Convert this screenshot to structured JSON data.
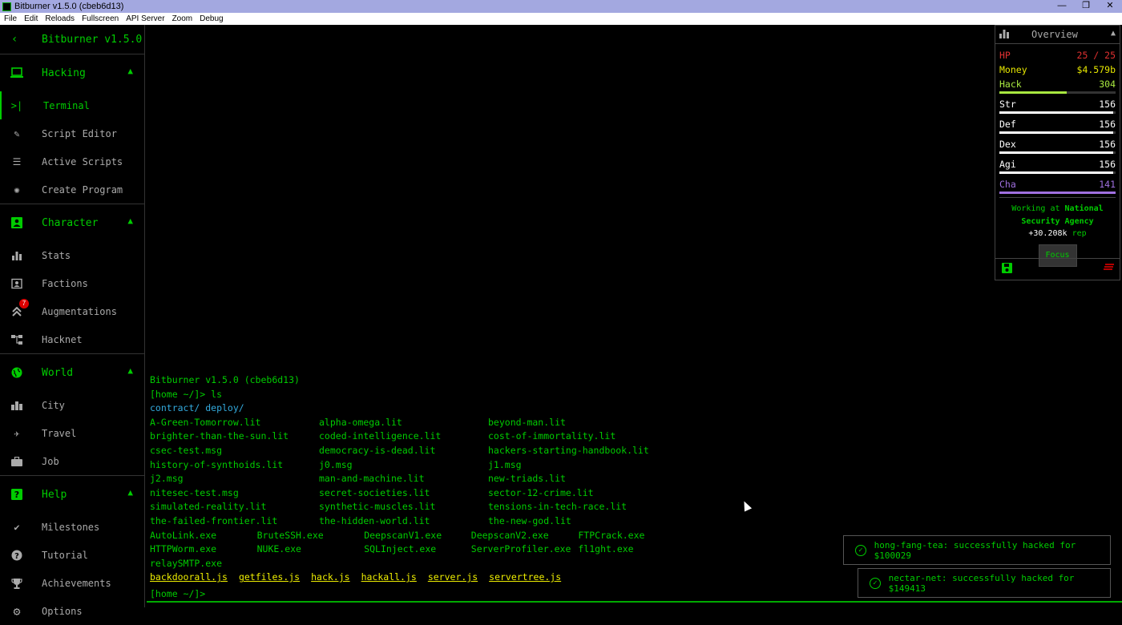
{
  "window": {
    "title": "Bitburner v1.5.0 (cbeb6d13)",
    "controls": [
      "—",
      "❐",
      "✕"
    ]
  },
  "menu": [
    "File",
    "Edit",
    "Reloads",
    "Fullscreen",
    "API Server",
    "Zoom",
    "Debug"
  ],
  "sidebar": {
    "title": "Bitburner v1.5.0",
    "back_icon": "chevron-left-icon",
    "categories": [
      {
        "label": "Hacking",
        "icon": "laptop-icon",
        "items": [
          {
            "label": "Terminal",
            "icon": "terminal-icon",
            "active": true
          },
          {
            "label": "Script Editor",
            "icon": "pencil-icon"
          },
          {
            "label": "Active Scripts",
            "icon": "list-icon"
          },
          {
            "label": "Create Program",
            "icon": "bug-icon"
          }
        ]
      },
      {
        "label": "Character",
        "icon": "account-box-icon",
        "items": [
          {
            "label": "Stats",
            "icon": "bar-chart-icon"
          },
          {
            "label": "Factions",
            "icon": "contacts-icon"
          },
          {
            "label": "Augmentations",
            "icon": "double-arrow-up-icon",
            "badge": "7"
          },
          {
            "label": "Hacknet",
            "icon": "account-tree-icon"
          }
        ]
      },
      {
        "label": "World",
        "icon": "globe-icon",
        "items": [
          {
            "label": "City",
            "icon": "city-icon"
          },
          {
            "label": "Travel",
            "icon": "airplane-icon"
          },
          {
            "label": "Job",
            "icon": "briefcase-icon"
          }
        ]
      },
      {
        "label": "Help",
        "icon": "help-icon",
        "items": [
          {
            "label": "Milestones",
            "icon": "check-icon"
          },
          {
            "label": "Tutorial",
            "icon": "help-circle-icon"
          },
          {
            "label": "Achievements",
            "icon": "trophy-icon"
          },
          {
            "label": "Options",
            "icon": "gear-icon"
          }
        ]
      }
    ]
  },
  "terminal": {
    "header": "Bitburner v1.5.0 (cbeb6d13)",
    "command": "[home ~/]> ls",
    "dirs": "contract/ deploy/",
    "lit_rows": [
      [
        "A-Green-Tomorrow.lit",
        "alpha-omega.lit",
        "beyond-man.lit"
      ],
      [
        "brighter-than-the-sun.lit",
        "coded-intelligence.lit",
        "cost-of-immortality.lit"
      ],
      [
        "csec-test.msg",
        "democracy-is-dead.lit",
        "hackers-starting-handbook.lit"
      ],
      [
        "history-of-synthoids.lit",
        "j0.msg",
        "j1.msg"
      ],
      [
        "j2.msg",
        "man-and-machine.lit",
        "new-triads.lit"
      ],
      [
        "nitesec-test.msg",
        "secret-societies.lit",
        "sector-12-crime.lit"
      ],
      [
        "simulated-reality.lit",
        "synthetic-muscles.lit",
        "tensions-in-tech-race.lit"
      ],
      [
        "the-failed-frontier.lit",
        "the-hidden-world.lit",
        "the-new-god.lit"
      ]
    ],
    "exe_rows": [
      [
        "AutoLink.exe",
        "BruteSSH.exe",
        "DeepscanV1.exe",
        "DeepscanV2.exe",
        "FTPCrack.exe"
      ],
      [
        "HTTPWorm.exe",
        "NUKE.exe",
        "SQLInject.exe",
        "ServerProfiler.exe",
        "fl1ght.exe"
      ],
      [
        "relaySMTP.exe"
      ]
    ],
    "scripts": [
      "backdoorall.js",
      "getfiles.js",
      "hack.js",
      "hackall.js",
      "server.js",
      "servertree.js"
    ],
    "prompt": "[home ~/]>"
  },
  "overview": {
    "title": "Overview",
    "hp": {
      "label": "HP",
      "value": "25 / 25",
      "color": "#e03030"
    },
    "money": {
      "label": "Money",
      "value": "$4.579b",
      "color": "#e8e800"
    },
    "stats": [
      {
        "label": "Hack",
        "value": "304",
        "color": "#a8e840",
        "progress": 0.58
      },
      {
        "label": "Str",
        "value": "156",
        "color": "#ffffff",
        "progress": 0.98
      },
      {
        "label": "Def",
        "value": "156",
        "color": "#ffffff",
        "progress": 0.98
      },
      {
        "label": "Dex",
        "value": "156",
        "color": "#ffffff",
        "progress": 0.98
      },
      {
        "label": "Agi",
        "value": "156",
        "color": "#ffffff",
        "progress": 0.98
      },
      {
        "label": "Cha",
        "value": "141",
        "color": "#a070e0",
        "progress": 1.0
      }
    ],
    "work_prefix": "Working at ",
    "work_place": "National Security Agency",
    "rep_value": "+30.208k",
    "rep_label": "rep",
    "focus_label": "Focus"
  },
  "toasts": [
    "hong-fang-tea: successfully hacked for $100029",
    "nectar-net: successfully hacked for $149413"
  ]
}
